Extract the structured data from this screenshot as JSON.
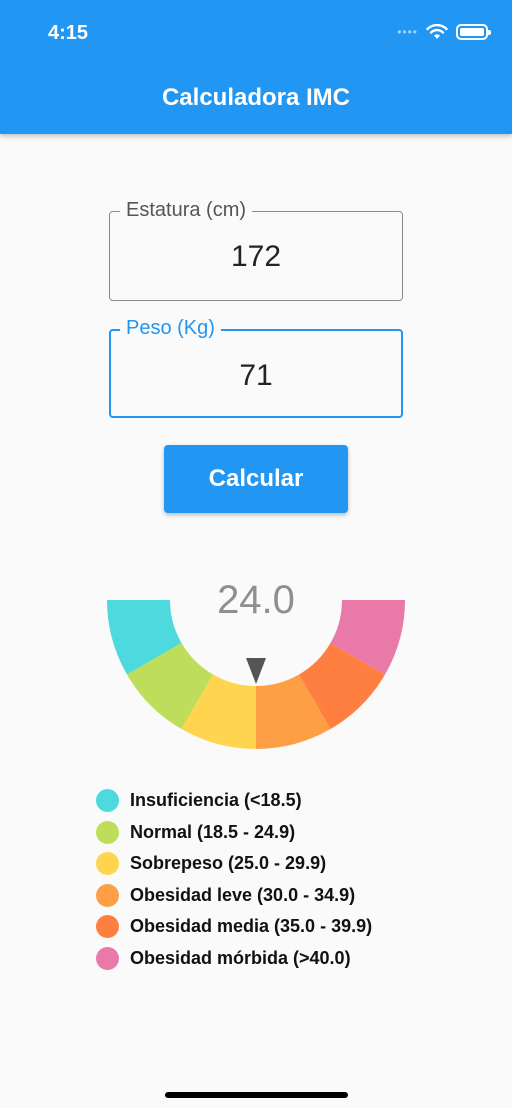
{
  "status_bar": {
    "time": "4:15"
  },
  "app_bar": {
    "title": "Calculadora IMC"
  },
  "form": {
    "height": {
      "label": "Estatura (cm)",
      "value": "172"
    },
    "weight": {
      "label": "Peso (Kg)",
      "value": "71"
    },
    "calculate_label": "Calcular"
  },
  "result": {
    "bmi_display": "24.0",
    "bmi": 24.0
  },
  "gauge": {
    "segments": [
      {
        "name": "Insuficiencia",
        "color": "#4DD9DE"
      },
      {
        "name": "Normal",
        "color": "#BEDD5A"
      },
      {
        "name": "Sobrepeso",
        "color": "#FFD54F"
      },
      {
        "name": "Obesidad leve",
        "color": "#FF9F45"
      },
      {
        "name": "Obesidad media",
        "color": "#FF7F40"
      },
      {
        "name": "Obesidad mórbida",
        "color": "#E879A9"
      }
    ]
  },
  "legend": [
    {
      "label": "Insuficiencia (<18.5)",
      "color": "#4DD9DE"
    },
    {
      "label": "Normal (18.5 - 24.9)",
      "color": "#BEDD5A"
    },
    {
      "label": "Sobrepeso (25.0 - 29.9)",
      "color": "#FFD54F"
    },
    {
      "label": "Obesidad leve (30.0 - 34.9)",
      "color": "#FF9F45"
    },
    {
      "label": "Obesidad media (35.0 - 39.9)",
      "color": "#FF7F40"
    },
    {
      "label": "Obesidad mórbida (>40.0)",
      "color": "#E879A9"
    }
  ]
}
